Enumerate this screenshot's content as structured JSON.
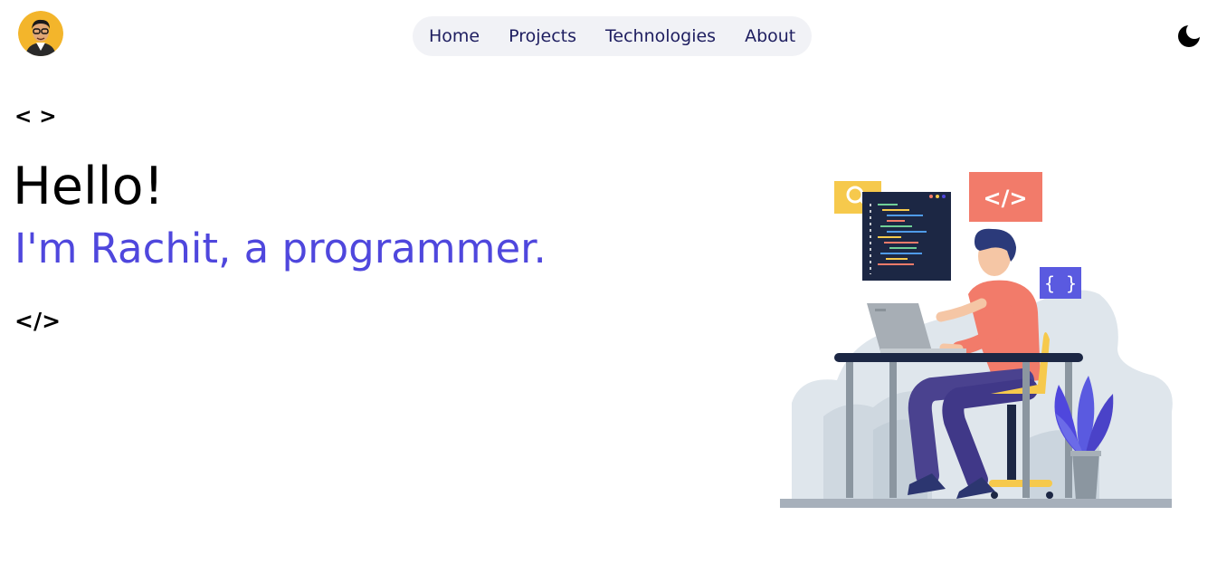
{
  "header": {
    "avatar_alt": "Rachit avatar",
    "nav": [
      {
        "label": "Home"
      },
      {
        "label": "Projects"
      },
      {
        "label": "Technologies"
      },
      {
        "label": "About"
      }
    ],
    "theme_icon": "moon-icon"
  },
  "hero": {
    "open_tag": "< >",
    "greeting": "Hello!",
    "intro": "I'm Rachit, a programmer.",
    "close_tag": "</>",
    "illustration_icons": [
      "search-icon",
      "code-tag-icon",
      "curly-braces-icon"
    ],
    "illustration_labels": {
      "code_tag": "</>",
      "braces": "{ }"
    }
  },
  "colors": {
    "accent": "#4f47dd",
    "nav_text": "#1e1e60",
    "nav_bg": "#f1f2f6"
  }
}
